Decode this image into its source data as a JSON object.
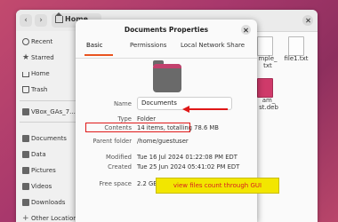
{
  "file_manager": {
    "path_label": "Home",
    "sidebar": [
      {
        "label": "Recent",
        "icon": "clock-icon"
      },
      {
        "label": "Starred",
        "icon": "star-icon"
      },
      {
        "label": "Home",
        "icon": "home-icon"
      },
      {
        "label": "Trash",
        "icon": "trash-icon"
      },
      {
        "label": "VBox_GAs_7....",
        "icon": "disc-icon"
      },
      {
        "label": "Documents",
        "icon": "folder-icon"
      },
      {
        "label": "Data",
        "icon": "folder-icon"
      },
      {
        "label": "Pictures",
        "icon": "folder-icon"
      },
      {
        "label": "Videos",
        "icon": "folder-icon"
      },
      {
        "label": "Downloads",
        "icon": "folder-icon"
      },
      {
        "label": "Other Locations",
        "icon": "plus-icon"
      }
    ],
    "files": [
      {
        "line1": "mple_",
        "line2": "txt"
      },
      {
        "line1": "file1.txt",
        "line2": ""
      },
      {
        "line1": "am_",
        "line2": "st.deb"
      }
    ]
  },
  "dialog": {
    "title": "Documents Properties",
    "tabs": [
      "Basic",
      "Permissions",
      "Local Network Share"
    ],
    "name_label": "Name",
    "name_value": "Documents",
    "properties": [
      {
        "label": "Type",
        "value": "Folder"
      },
      {
        "label": "Contents",
        "value": "14 items, totalling 78.6 MB"
      },
      {
        "label": "Parent folder",
        "value": "/home/guestuser"
      },
      {
        "label": "Modified",
        "value": "Tue 16 Jul 2024 01:22:08 PM EDT"
      },
      {
        "label": "Created",
        "value": "Tue 25 Jun 2024 05:41:02 PM EDT"
      },
      {
        "label": "Free space",
        "value": "2.2 GB"
      }
    ]
  },
  "annotation": {
    "note": "view files count through GUI",
    "highlight_color": "#e01818",
    "note_bg": "#f2e600"
  },
  "colors": {
    "accent": "#e95420",
    "folder_tab": "#c2416d",
    "desktop": "#a8386c"
  }
}
